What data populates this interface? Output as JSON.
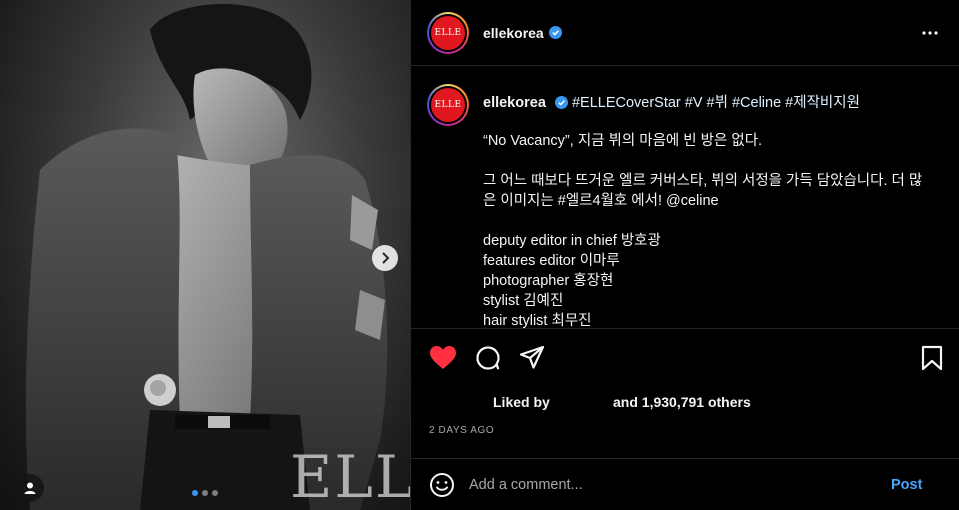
{
  "post": {
    "username": "ellekorea",
    "avatar_text": "ELLE",
    "verified": true,
    "more_icon": "more-horizontal-icon"
  },
  "photo": {
    "watermark": "ELLE",
    "carousel": {
      "count": 3,
      "current": 1
    },
    "icons": {
      "next": "chevron-right-icon",
      "tag": "user-icon"
    }
  },
  "caption": {
    "username": "ellekorea",
    "hashtags": "#ELLECoverStar #V #뷔 #Celine #제작비지원",
    "line1": "“No Vacancy”, 지금 뷔의 마음에 빈 방은 없다.",
    "line2": "그 어느 때보다 뜨거운 엘르 커버스타, 뷔의 서정을 가득 담았습니다. 더 많은 이미지는 #엘르4월호 에서! @celine",
    "credits": [
      "deputy editor in chief 방호광",
      "features editor 이마루",
      "photographer 홍장현",
      "stylist 김예진",
      "hair stylist 최무진"
    ]
  },
  "actions": {
    "icons": [
      "heart-icon",
      "comment-icon",
      "share-icon",
      "bookmark-icon"
    ],
    "liked": true,
    "accent_color": "#ff3040"
  },
  "likes": {
    "prefix": "Liked by",
    "suffix": "and 1,930,791 others"
  },
  "timestamp": "2 DAYS AGO",
  "comment": {
    "placeholder": "Add a comment...",
    "post_label": "Post",
    "post_color": "#4aa5ff"
  }
}
